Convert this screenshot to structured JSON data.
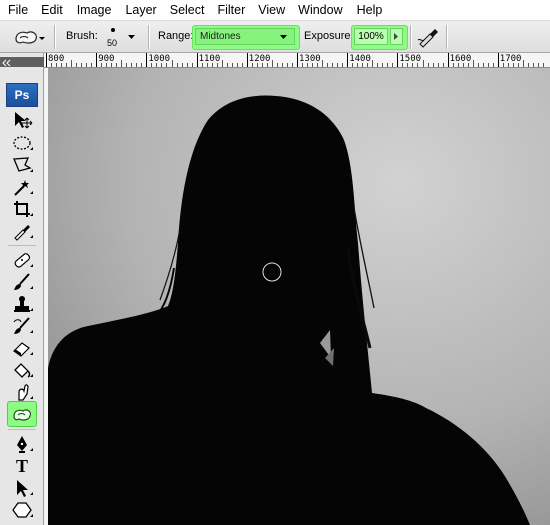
{
  "menu": [
    "File",
    "Edit",
    "Image",
    "Layer",
    "Select",
    "Filter",
    "View",
    "Window",
    "Help"
  ],
  "options": {
    "brush_label": "Brush:",
    "brush_size": "50",
    "range_label": "Range:",
    "range_value": "Midtones",
    "exposure_label": "Exposure:",
    "exposure_value": "100%"
  },
  "toolbox": {
    "logo": "Ps",
    "text_tool_glyph": "T"
  },
  "ruler": {
    "labels": [
      "800",
      "900",
      "1000",
      "1100",
      "1200",
      "1300",
      "1400",
      "1500",
      "1600",
      "1700"
    ]
  },
  "colors": {
    "highlight": "#8dfb84",
    "silhouette": "#050505"
  },
  "icons": {
    "active_tool": "sponge-icon"
  }
}
